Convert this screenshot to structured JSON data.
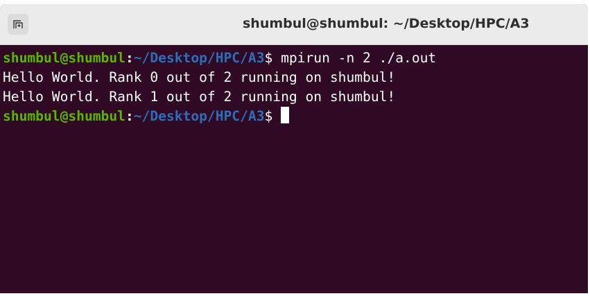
{
  "window": {
    "title": "shumbul@shumbul: ~/Desktop/HPC/A3",
    "new_tab_icon": "new-tab-icon"
  },
  "colors": {
    "background": "#300a24",
    "prompt_user": "#5ab600",
    "prompt_path": "#2e6db8",
    "text": "#ffffff"
  },
  "terminal": {
    "prompt1": {
      "user_host": "shumbul@shumbul",
      "separator": ":",
      "path": "~/Desktop/HPC/A3",
      "symbol": "$",
      "command": " mpirun -n 2 ./a.out"
    },
    "output": [
      "Hello World. Rank 0 out of 2 running on shumbul!",
      "Hello World. Rank 1 out of 2 running on shumbul!"
    ],
    "prompt2": {
      "user_host": "shumbul@shumbul",
      "separator": ":",
      "path": "~/Desktop/HPC/A3",
      "symbol": "$"
    }
  }
}
